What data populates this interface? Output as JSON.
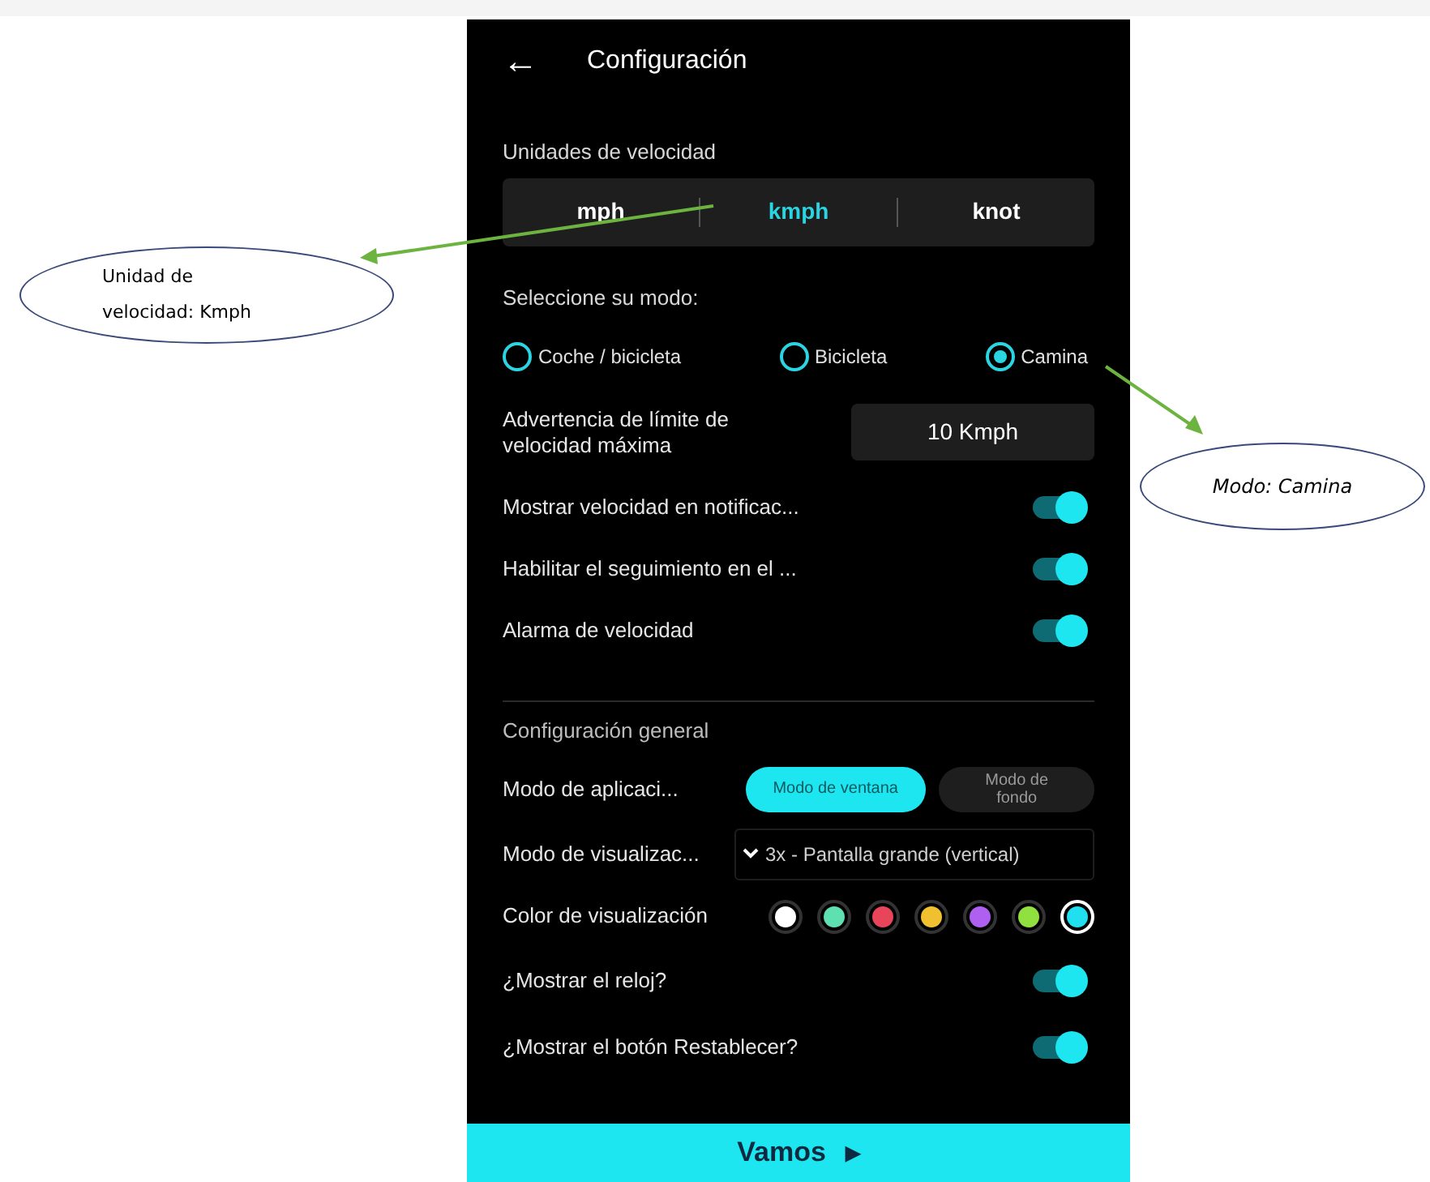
{
  "header": {
    "back_icon": "←",
    "title": "Configuración"
  },
  "units": {
    "label": "Unidades de velocidad",
    "options": [
      {
        "label": "mph",
        "selected": false
      },
      {
        "label": "kmph",
        "selected": true
      },
      {
        "label": "knot",
        "selected": false
      }
    ]
  },
  "mode": {
    "label": "Seleccione su modo:",
    "options": [
      {
        "label": "Coche / bicicleta",
        "selected": false
      },
      {
        "label": "Bicicleta",
        "selected": false
      },
      {
        "label": "Camina",
        "selected": true
      }
    ]
  },
  "speed_limit": {
    "label": "Advertencia de límite de velocidad máxima",
    "value": "10 Kmph"
  },
  "toggles": [
    {
      "label": "Mostrar velocidad en notificac...",
      "on": true
    },
    {
      "label": "Habilitar el seguimiento en el ...",
      "on": true
    },
    {
      "label": "Alarma de velocidad",
      "on": true
    }
  ],
  "general": {
    "title": "Configuración general",
    "app_mode": {
      "label": "Modo de aplicaci...",
      "options": [
        {
          "label": "Modo de ventana",
          "selected": true
        },
        {
          "label": "Modo de fondo",
          "selected": false
        }
      ]
    },
    "display_mode": {
      "label": "Modo de visualizac...",
      "value": "3x - Pantalla grande (vertical)"
    },
    "display_color": {
      "label": "Color de visualización",
      "colors": [
        {
          "color": "#ffffff",
          "selected": false
        },
        {
          "color": "#5ee0b0",
          "selected": false
        },
        {
          "color": "#e8455a",
          "selected": false
        },
        {
          "color": "#f0c030",
          "selected": false
        },
        {
          "color": "#b060f0",
          "selected": false
        },
        {
          "color": "#90e040",
          "selected": false
        },
        {
          "color": "#20e0f0",
          "selected": true
        }
      ]
    },
    "toggles": [
      {
        "label": "¿Mostrar el reloj?",
        "on": true
      },
      {
        "label": "¿Mostrar el botón Restablecer?",
        "on": true
      }
    ]
  },
  "go_button": {
    "label": "Vamos",
    "icon": "▶"
  },
  "callouts": [
    {
      "text": "Unidad de velocidad: Kmph"
    },
    {
      "text": "Modo: Camina"
    }
  ]
}
